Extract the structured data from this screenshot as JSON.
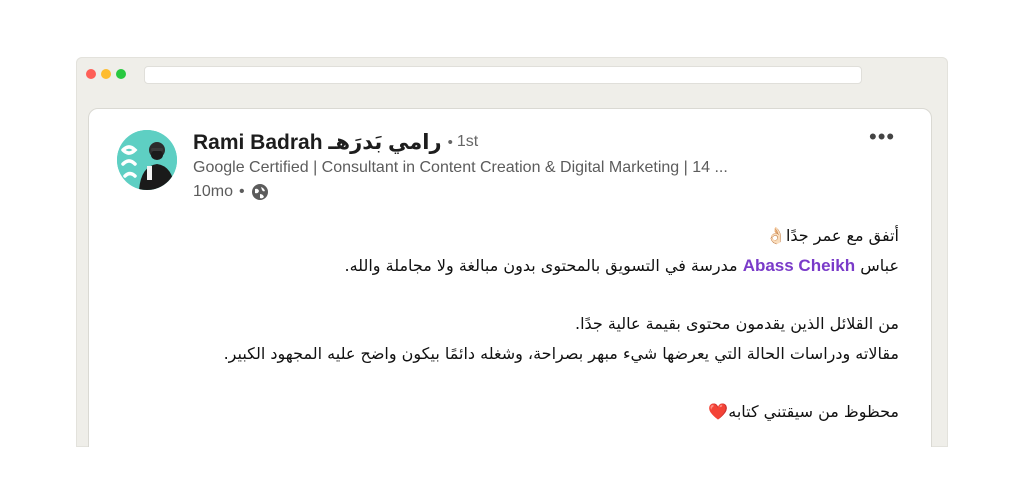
{
  "post": {
    "author": {
      "name": "Rami Badrah رامي بَدرَهـ",
      "connection": "1st",
      "headline": "Google Certified | Consultant in Content Creation & Digital Marketing | 14 ...",
      "time": "10mo"
    },
    "lines": {
      "l1": "أتفق مع عمر جدًا👌🏻",
      "l2_before": "عباس ",
      "mention": "Abass Cheikh",
      "l2_after": " مدرسة في التسويق بالمحتوى بدون مبالغة ولا مجاملة والله.",
      "l3": "من القلائل الذين يقدمون محتوى بقيمة عالية جدًا.",
      "l4": "مقالاته ودراسات الحالة التي يعرضها شيء مبهر بصراحة، وشغله دائمًا بيكون واضح عليه المجهود الكبير.",
      "l5": "محظوظ من سيقتني كتابه",
      "heart": "❤️"
    }
  },
  "icons": {
    "more": "more-horizontal-icon",
    "visibility": "globe-icon"
  },
  "colors": {
    "mention": "#7a3bc9",
    "avatar_bg": "#5ecfc3",
    "window_frame": "#efeee9"
  }
}
